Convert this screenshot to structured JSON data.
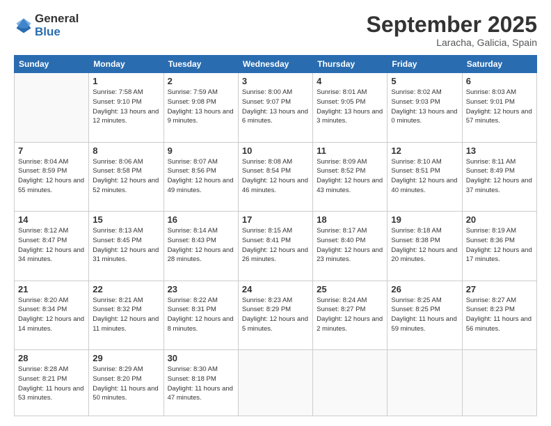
{
  "logo": {
    "general": "General",
    "blue": "Blue"
  },
  "header": {
    "month": "September 2025",
    "location": "Laracha, Galicia, Spain"
  },
  "weekdays": [
    "Sunday",
    "Monday",
    "Tuesday",
    "Wednesday",
    "Thursday",
    "Friday",
    "Saturday"
  ],
  "weeks": [
    [
      {
        "day": "",
        "sunrise": "",
        "sunset": "",
        "daylight": ""
      },
      {
        "day": "1",
        "sunrise": "Sunrise: 7:58 AM",
        "sunset": "Sunset: 9:10 PM",
        "daylight": "Daylight: 13 hours and 12 minutes."
      },
      {
        "day": "2",
        "sunrise": "Sunrise: 7:59 AM",
        "sunset": "Sunset: 9:08 PM",
        "daylight": "Daylight: 13 hours and 9 minutes."
      },
      {
        "day": "3",
        "sunrise": "Sunrise: 8:00 AM",
        "sunset": "Sunset: 9:07 PM",
        "daylight": "Daylight: 13 hours and 6 minutes."
      },
      {
        "day": "4",
        "sunrise": "Sunrise: 8:01 AM",
        "sunset": "Sunset: 9:05 PM",
        "daylight": "Daylight: 13 hours and 3 minutes."
      },
      {
        "day": "5",
        "sunrise": "Sunrise: 8:02 AM",
        "sunset": "Sunset: 9:03 PM",
        "daylight": "Daylight: 13 hours and 0 minutes."
      },
      {
        "day": "6",
        "sunrise": "Sunrise: 8:03 AM",
        "sunset": "Sunset: 9:01 PM",
        "daylight": "Daylight: 12 hours and 57 minutes."
      }
    ],
    [
      {
        "day": "7",
        "sunrise": "Sunrise: 8:04 AM",
        "sunset": "Sunset: 8:59 PM",
        "daylight": "Daylight: 12 hours and 55 minutes."
      },
      {
        "day": "8",
        "sunrise": "Sunrise: 8:06 AM",
        "sunset": "Sunset: 8:58 PM",
        "daylight": "Daylight: 12 hours and 52 minutes."
      },
      {
        "day": "9",
        "sunrise": "Sunrise: 8:07 AM",
        "sunset": "Sunset: 8:56 PM",
        "daylight": "Daylight: 12 hours and 49 minutes."
      },
      {
        "day": "10",
        "sunrise": "Sunrise: 8:08 AM",
        "sunset": "Sunset: 8:54 PM",
        "daylight": "Daylight: 12 hours and 46 minutes."
      },
      {
        "day": "11",
        "sunrise": "Sunrise: 8:09 AM",
        "sunset": "Sunset: 8:52 PM",
        "daylight": "Daylight: 12 hours and 43 minutes."
      },
      {
        "day": "12",
        "sunrise": "Sunrise: 8:10 AM",
        "sunset": "Sunset: 8:51 PM",
        "daylight": "Daylight: 12 hours and 40 minutes."
      },
      {
        "day": "13",
        "sunrise": "Sunrise: 8:11 AM",
        "sunset": "Sunset: 8:49 PM",
        "daylight": "Daylight: 12 hours and 37 minutes."
      }
    ],
    [
      {
        "day": "14",
        "sunrise": "Sunrise: 8:12 AM",
        "sunset": "Sunset: 8:47 PM",
        "daylight": "Daylight: 12 hours and 34 minutes."
      },
      {
        "day": "15",
        "sunrise": "Sunrise: 8:13 AM",
        "sunset": "Sunset: 8:45 PM",
        "daylight": "Daylight: 12 hours and 31 minutes."
      },
      {
        "day": "16",
        "sunrise": "Sunrise: 8:14 AM",
        "sunset": "Sunset: 8:43 PM",
        "daylight": "Daylight: 12 hours and 28 minutes."
      },
      {
        "day": "17",
        "sunrise": "Sunrise: 8:15 AM",
        "sunset": "Sunset: 8:41 PM",
        "daylight": "Daylight: 12 hours and 26 minutes."
      },
      {
        "day": "18",
        "sunrise": "Sunrise: 8:17 AM",
        "sunset": "Sunset: 8:40 PM",
        "daylight": "Daylight: 12 hours and 23 minutes."
      },
      {
        "day": "19",
        "sunrise": "Sunrise: 8:18 AM",
        "sunset": "Sunset: 8:38 PM",
        "daylight": "Daylight: 12 hours and 20 minutes."
      },
      {
        "day": "20",
        "sunrise": "Sunrise: 8:19 AM",
        "sunset": "Sunset: 8:36 PM",
        "daylight": "Daylight: 12 hours and 17 minutes."
      }
    ],
    [
      {
        "day": "21",
        "sunrise": "Sunrise: 8:20 AM",
        "sunset": "Sunset: 8:34 PM",
        "daylight": "Daylight: 12 hours and 14 minutes."
      },
      {
        "day": "22",
        "sunrise": "Sunrise: 8:21 AM",
        "sunset": "Sunset: 8:32 PM",
        "daylight": "Daylight: 12 hours and 11 minutes."
      },
      {
        "day": "23",
        "sunrise": "Sunrise: 8:22 AM",
        "sunset": "Sunset: 8:31 PM",
        "daylight": "Daylight: 12 hours and 8 minutes."
      },
      {
        "day": "24",
        "sunrise": "Sunrise: 8:23 AM",
        "sunset": "Sunset: 8:29 PM",
        "daylight": "Daylight: 12 hours and 5 minutes."
      },
      {
        "day": "25",
        "sunrise": "Sunrise: 8:24 AM",
        "sunset": "Sunset: 8:27 PM",
        "daylight": "Daylight: 12 hours and 2 minutes."
      },
      {
        "day": "26",
        "sunrise": "Sunrise: 8:25 AM",
        "sunset": "Sunset: 8:25 PM",
        "daylight": "Daylight: 11 hours and 59 minutes."
      },
      {
        "day": "27",
        "sunrise": "Sunrise: 8:27 AM",
        "sunset": "Sunset: 8:23 PM",
        "daylight": "Daylight: 11 hours and 56 minutes."
      }
    ],
    [
      {
        "day": "28",
        "sunrise": "Sunrise: 8:28 AM",
        "sunset": "Sunset: 8:21 PM",
        "daylight": "Daylight: 11 hours and 53 minutes."
      },
      {
        "day": "29",
        "sunrise": "Sunrise: 8:29 AM",
        "sunset": "Sunset: 8:20 PM",
        "daylight": "Daylight: 11 hours and 50 minutes."
      },
      {
        "day": "30",
        "sunrise": "Sunrise: 8:30 AM",
        "sunset": "Sunset: 8:18 PM",
        "daylight": "Daylight: 11 hours and 47 minutes."
      },
      {
        "day": "",
        "sunrise": "",
        "sunset": "",
        "daylight": ""
      },
      {
        "day": "",
        "sunrise": "",
        "sunset": "",
        "daylight": ""
      },
      {
        "day": "",
        "sunrise": "",
        "sunset": "",
        "daylight": ""
      },
      {
        "day": "",
        "sunrise": "",
        "sunset": "",
        "daylight": ""
      }
    ]
  ]
}
